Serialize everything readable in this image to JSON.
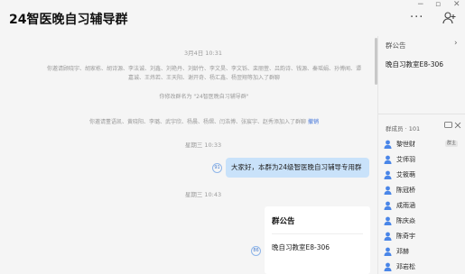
{
  "window": {
    "title": "24智医晚自习辅导群",
    "controls": [
      "−",
      "▫",
      "✕"
    ],
    "more_label": "···"
  },
  "chat": {
    "timestamp_1": "3月4日 10:31",
    "invite_notice": "你邀请顾晓宇、胡家栋、胡诗源、李法诚、刘鑫、刘艳丹、刘龄竹、李文昊、李文铄、栾丽萱、吕韵诗、钱源、秦瑶娟、孙博闻、谭嘉诚、王炜若、王天阳、谢开奇、杨汇鑫、杨翌翔等加入了群聊",
    "rename_notice": "你修改群名为 \"24智医晚自习辅导群\"",
    "invite_notice_2": "你邀请董语凯、黄晓阳、李璐、武宇欣、杨晨、杨熠、闫浩博、张宸宇、赵秀添加入了群聊",
    "undo_link": "撤销",
    "timestamp_2": "星期三 10:33",
    "message_1": "大家好，本群为24级智医晚自习辅导专用群",
    "read_count_1": "91",
    "timestamp_3": "星期三 10:43",
    "card_title": "群公告",
    "card_body": "晚自习教室E8-306",
    "read_count_2": "86"
  },
  "sidebar": {
    "notice_heading": "群公告",
    "notice_chevron": "›",
    "notice_text": "晚自习教室E8-306",
    "members_heading": "群成员 · 101",
    "members": [
      {
        "name": "黎世财",
        "badge": "群主"
      },
      {
        "name": "艾师羽",
        "badge": ""
      },
      {
        "name": "艾筱萌",
        "badge": ""
      },
      {
        "name": "陈冠桥",
        "badge": ""
      },
      {
        "name": "成雨涵",
        "badge": ""
      },
      {
        "name": "陈庆焱",
        "badge": ""
      },
      {
        "name": "陈奇宇",
        "badge": ""
      },
      {
        "name": "邓赫",
        "badge": ""
      },
      {
        "name": "邓岩松",
        "badge": ""
      }
    ]
  },
  "colors": {
    "accent": "#3b6fd8",
    "bubble": "#c9e2fa",
    "member_icon": "#4a86e8"
  }
}
